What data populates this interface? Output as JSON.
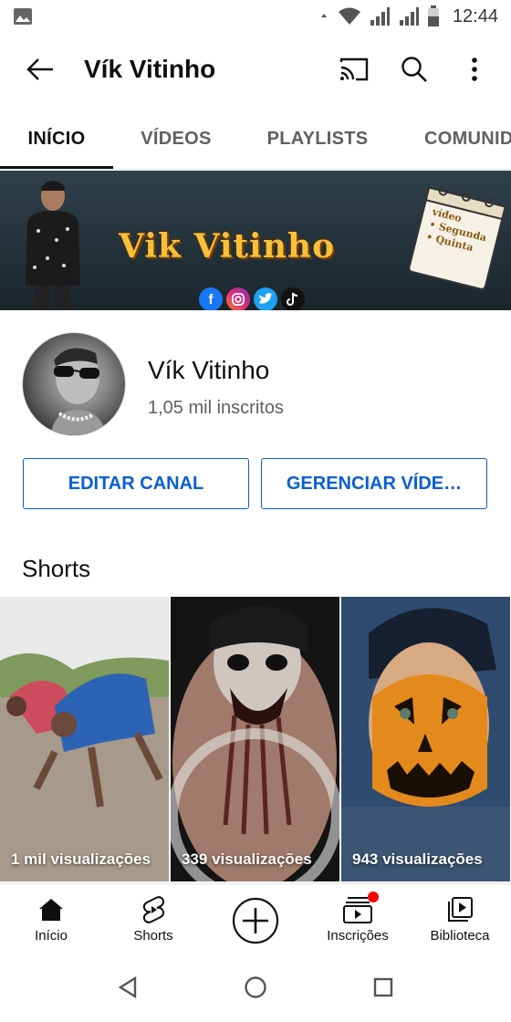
{
  "status_bar": {
    "time": "12:44",
    "icons": [
      "gallery-icon",
      "wifi-icon",
      "signal-icon",
      "signal-icon",
      "battery-icon"
    ]
  },
  "app_bar": {
    "title": "Vík Vitinho",
    "icons": [
      "back-arrow-icon",
      "cast-icon",
      "search-icon",
      "more-vert-icon"
    ]
  },
  "tabs": [
    {
      "label": "INÍCIO",
      "active": true
    },
    {
      "label": "VÍDEOS",
      "active": false
    },
    {
      "label": "PLAYLISTS",
      "active": false
    },
    {
      "label": "COMUNID",
      "active": false
    }
  ],
  "banner": {
    "title": "Vik Vitinho",
    "calendar_text": [
      "vídeo",
      "• Segunda",
      "• Quinta"
    ],
    "social": [
      "f",
      "IG",
      "tw",
      "tt"
    ]
  },
  "channel": {
    "name": "Vík Vitinho",
    "subscribers": "1,05 mil inscritos"
  },
  "buttons": {
    "edit": "EDITAR CANAL",
    "manage": "GERENCIAR VÍDE…"
  },
  "shorts": {
    "title": "Shorts",
    "items": [
      {
        "views": "1 mil visualizações"
      },
      {
        "views": "339 visualizações"
      },
      {
        "views": "943 visualizações"
      }
    ]
  },
  "bottom_nav": [
    {
      "label": "Início",
      "icon": "home-icon",
      "active": true
    },
    {
      "label": "Shorts",
      "icon": "shorts-icon",
      "active": false
    },
    {
      "label": "",
      "icon": "create-icon",
      "active": false
    },
    {
      "label": "Inscrições",
      "icon": "subscriptions-icon",
      "active": false
    },
    {
      "label": "Biblioteca",
      "icon": "library-icon",
      "active": false
    }
  ],
  "colors": {
    "accent": "#065fd4",
    "notification": "#ff0000",
    "banner_title": "#f6c03a"
  }
}
